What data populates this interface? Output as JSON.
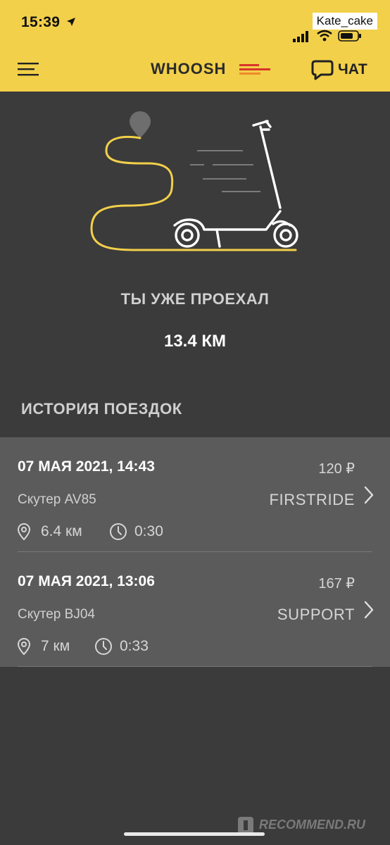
{
  "status_bar": {
    "time": "15:39",
    "watermark_user": "Kate_cake"
  },
  "header": {
    "logo": "WHOOSH",
    "chat_label": "ЧАТ"
  },
  "stats": {
    "label": "ТЫ УЖЕ ПРОЕХАЛ",
    "value": "13.4 КМ"
  },
  "history": {
    "title": "ИСТОРИЯ ПОЕЗДОК",
    "trips": [
      {
        "date": "07 МАЯ 2021, 14:43",
        "price": "120 ₽",
        "scooter": "Скутер AV85",
        "promo": "FIRSTRIDE",
        "distance": "6.4 км",
        "duration": "0:30"
      },
      {
        "date": "07 МАЯ 2021, 13:06",
        "price": "167 ₽",
        "scooter": "Скутер BJ04",
        "promo": "SUPPORT",
        "distance": "7 км",
        "duration": "0:33"
      }
    ]
  },
  "footer": {
    "watermark": "RECOMMEND.RU"
  },
  "colors": {
    "accent_yellow": "#f2d04a",
    "background": "#3b3b3b",
    "list_background": "#5b5b5b",
    "logo_stripe_red": "#d9342b",
    "logo_stripe_orange": "#ef8a2a"
  },
  "icons": {
    "menu": "hamburger-icon",
    "chat": "chat-bubble-icon",
    "location": "location-pin-icon",
    "clock": "clock-icon",
    "chevron": "chevron-right-icon",
    "signal": "cellular-signal-icon",
    "wifi": "wifi-icon",
    "battery": "battery-icon",
    "navigation": "location-arrow-icon"
  }
}
